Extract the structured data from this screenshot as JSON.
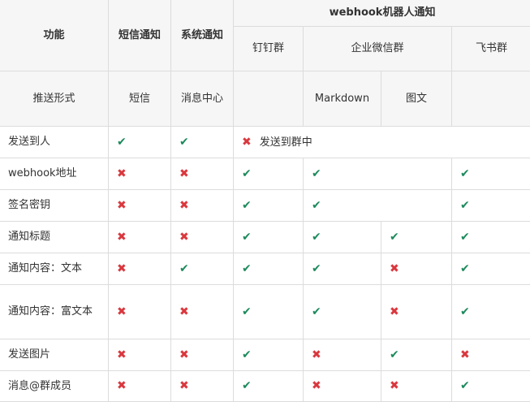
{
  "header": {
    "feature": "功能",
    "sms": "短信通知",
    "system": "系统通知",
    "webhook": "webhook机器人通知",
    "dingtalk": "钉钉群",
    "wecom": "企业微信群",
    "feishu": "飞书群",
    "push_format": "推送形式",
    "sms_format": "短信",
    "system_format": "消息中心",
    "wecom_markdown": "Markdown",
    "wecom_image": "图文"
  },
  "symbols": {
    "yes": "✔",
    "no": "✖"
  },
  "colors": {
    "yes": "#1d8a5c",
    "no": "#d9383e"
  },
  "rows": [
    {
      "feature": "发送到人",
      "sms": "y",
      "system": "y",
      "merged_all": {
        "mark": "n",
        "text": "发送到群中"
      }
    },
    {
      "feature": "webhook地址",
      "sms": "n",
      "system": "n",
      "dingtalk": "y",
      "wecom_merged": "y",
      "feishu": "y"
    },
    {
      "feature": "签名密钥",
      "sms": "n",
      "system": "n",
      "dingtalk": "y",
      "wecom_merged": "y",
      "feishu": "y"
    },
    {
      "feature": "通知标题",
      "sms": "n",
      "system": "n",
      "dingtalk": "y",
      "wecom_markdown": "y",
      "wecom_image": "y",
      "feishu": "y"
    },
    {
      "feature": "通知内容：文本",
      "sms": "n",
      "system": "y",
      "dingtalk": "y",
      "wecom_markdown": "y",
      "wecom_image": "n",
      "feishu": "y"
    },
    {
      "feature": "通知内容：富文本",
      "sms": "n",
      "system": "n",
      "dingtalk": "y",
      "wecom_markdown": "y",
      "wecom_image": "n",
      "feishu": "y"
    },
    {
      "feature": "发送图片",
      "sms": "n",
      "system": "n",
      "dingtalk": "y",
      "wecom_markdown": "n",
      "wecom_image": "y",
      "feishu": "n"
    },
    {
      "feature": "消息@群成员",
      "sms": "n",
      "system": "n",
      "dingtalk": "y",
      "wecom_markdown": "n",
      "wecom_image": "n",
      "feishu": "y"
    }
  ]
}
